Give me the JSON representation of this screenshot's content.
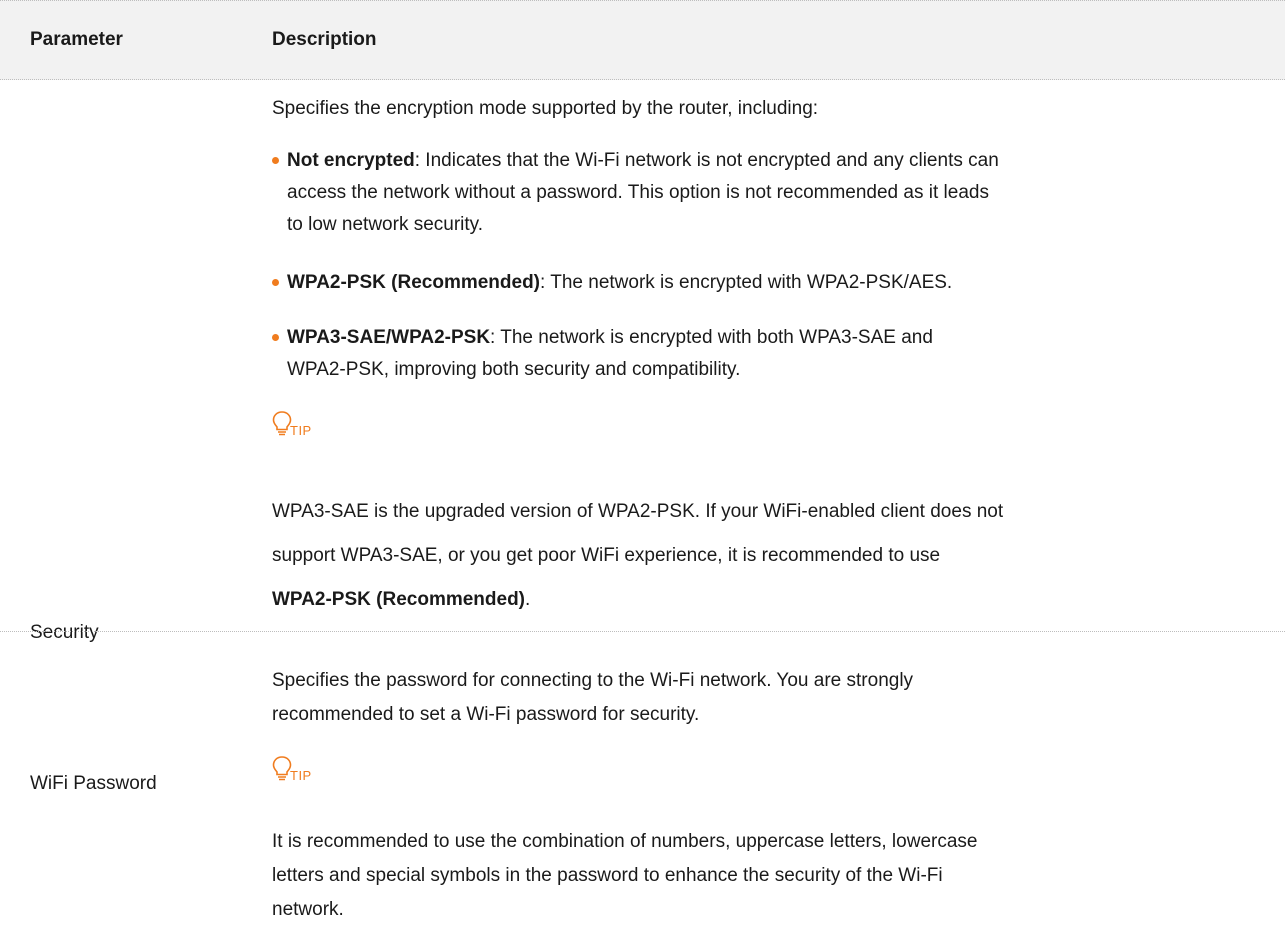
{
  "header": {
    "parameter": "Parameter",
    "description": "Description"
  },
  "rows": [
    {
      "parameter": "Security",
      "intro": "Specifies the encryption mode supported by the router, including:",
      "bullets": [
        {
          "term": "Not encrypted",
          "text_lines": [
            ": Indicates that the Wi-Fi network is not encrypted and any clients can",
            "access the network without a password. This option is not recommended as it leads",
            "to low network security."
          ]
        },
        {
          "term": "WPA2-PSK (Recommended)",
          "text_lines": [
            ": The network is encrypted with WPA2-PSK/AES."
          ]
        },
        {
          "term": "WPA3-SAE/WPA2-PSK",
          "text_lines": [
            ": The network is encrypted with both WPA3-SAE and",
            "WPA2-PSK, improving both security and compatibility."
          ]
        }
      ],
      "tip_label": "TIP",
      "tip_lines": [
        "WPA3-SAE is the upgraded version of WPA2-PSK. If your WiFi-enabled client does not",
        "support WPA3-SAE, or you get poor WiFi experience, it is recommended to use"
      ],
      "tip_bold": "WPA2-PSK (Recommended)",
      "tip_end": "."
    },
    {
      "parameter": "WiFi Password",
      "intro_lines": [
        "Specifies the password for connecting to the Wi-Fi network. You are strongly",
        "recommended to set a Wi-Fi password for security."
      ],
      "tip_label": "TIP",
      "tip_lines": [
        "It is recommended to use the combination of numbers, uppercase letters, lowercase",
        "letters and special symbols in the password to enhance the security of the Wi-Fi",
        "network."
      ]
    }
  ],
  "colors": {
    "accent": "#f07c1e",
    "header_bg": "#f2f2f2",
    "text": "#1a1a1a"
  },
  "icons": {
    "tip": "lightbulb-icon",
    "bullet": "bullet-dot-icon"
  }
}
